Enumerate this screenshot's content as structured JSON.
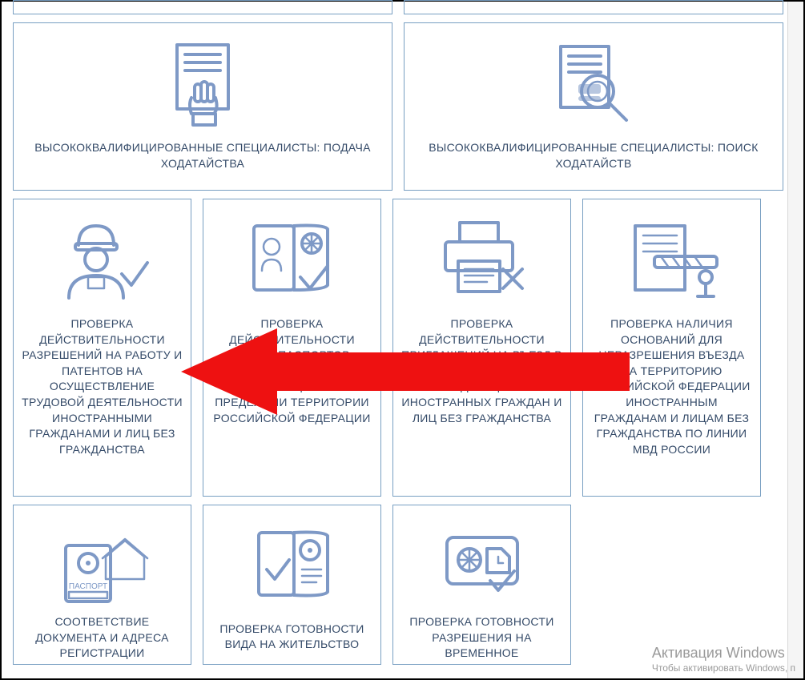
{
  "cards": {
    "submit_petition": "ВЫСОКОКВАЛИФИЦИРОВАННЫЕ СПЕЦИАЛИСТЫ: ПОДАЧА ХОДАТАЙСТВА",
    "search_petition": "ВЫСОКОКВАЛИФИЦИРОВАННЫЕ СПЕЦИАЛИСТЫ: ПОИСК ХОДАТАЙСТВ",
    "check_work_permit": "ПРОВЕРКА ДЕЙСТВИТЕЛЬНОСТИ РАЗРЕШЕНИЙ НА РАБОТУ И ПАТЕНТОВ НА ОСУЩЕСТВЛЕНИЕ ТРУДОВОЙ ДЕЯТЕЛЬНОСТИ ИНОСТРАННЫМИ ГРАЖДАНАМИ И ЛИЦ БЕЗ ГРАЖДАНСТВА",
    "check_passport_abroad": "ПРОВЕРКА ДЕЙСТВИТЕЛЬНОСТИ ЗАГРАНПАСПОРТОВ ГРАЖДАН РОССИЙСКОЙ ФЕДЕРАЦИИ ЗА ПРЕДЕЛАМИ ТЕРРИТОРИИ РОССИЙСКОЙ ФЕДЕРАЦИИ",
    "check_invite": "ПРОВЕРКА ДЕЙСТВИТЕЛЬНОСТИ ПРИГЛАШЕНИЙ НА ВЪЕЗД В РОССИЙСКУЮ ФЕДЕРАЦИЮ ИНОСТРАННЫХ ГРАЖДАН И ЛИЦ БЕЗ ГРАЖДАНСТВА",
    "check_entry_ban": "ПРОВЕРКА НАЛИЧИЯ ОСНОВАНИЙ ДЛЯ НЕРАЗРЕШЕНИЯ ВЪЕЗДА НА ТЕРРИТОРИЮ РОССИЙСКОЙ ФЕДЕРАЦИИ ИНОСТРАННЫМ ГРАЖДАНАМ И ЛИЦАМ БЕЗ ГРАЖДАНСТВА ПО ЛИНИИ МВД РОССИИ",
    "doc_address_match": "СООТВЕТСТВИЕ ДОКУМЕНТА И АДРЕСА РЕГИСТРАЦИИ",
    "check_residence": "ПРОВЕРКА ГОТОВНОСТИ ВИДА НА ЖИТЕЛЬСТВО",
    "check_temporary": "ПРОВЕРКА ГОТОВНОСТИ РАЗРЕШЕНИЯ НА ВРЕМЕННОЕ"
  },
  "watermark": {
    "line1": "Активация Windows",
    "line2": "Чтобы активировать Windows, п"
  }
}
